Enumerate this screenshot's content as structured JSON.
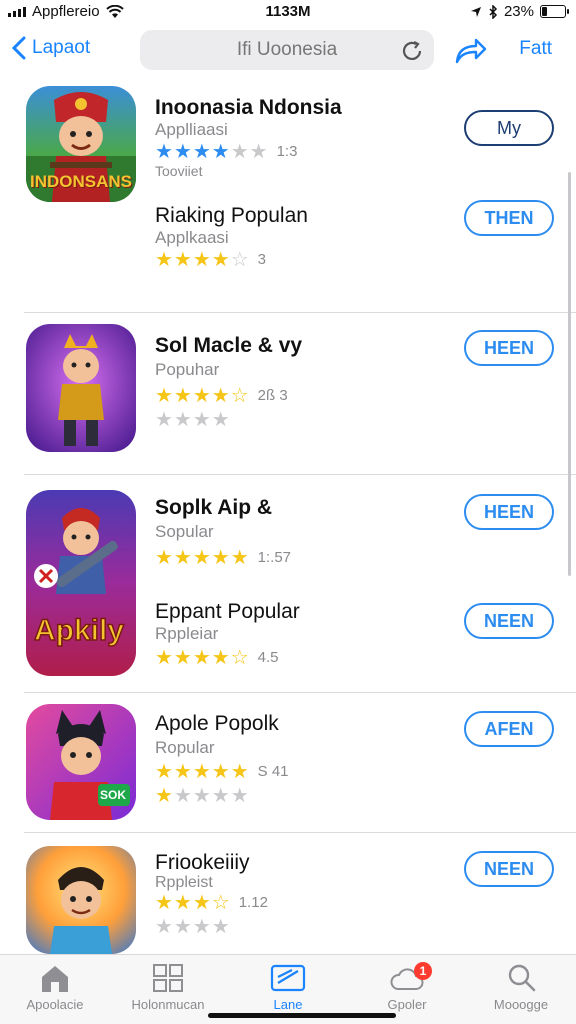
{
  "status_bar": {
    "carrier": "Appflereio",
    "time": "1133M",
    "battery": "23%",
    "battery_level": 0.23
  },
  "nav": {
    "back_label": "Lapaot",
    "search_text": "Ifi Uoonesia",
    "action_label": "Fatt"
  },
  "apps": [
    {
      "title": "Inoonasia Ndonsia",
      "subtitle": "Applliaasi",
      "stars_text": "★★★★",
      "stars_off_text": "★★",
      "rating_text": "1:3",
      "extra": "Tooviiet",
      "button": "My",
      "icon_caption": "INDONSANS"
    },
    {
      "title": "Riaking Populan",
      "subtitle": "Applkaasi",
      "stars_text": "★★★★",
      "stars_off_text": "☆",
      "rating_text": "3",
      "button": "THEN"
    },
    {
      "title": "Sol Macle & vy",
      "subtitle": "Popuhar",
      "stars_text": "★★★★☆",
      "rating_text": "2ß 3",
      "stars2_off_text": "★★★★",
      "button": "HEEN"
    },
    {
      "title": "Soplk Aip &",
      "subtitle": "Sopular",
      "stars_text": "★★★★★",
      "rating_text": "1:.57",
      "button": "HEEN",
      "icon_caption": "Apkily"
    },
    {
      "title": "Eppant Popular",
      "subtitle": "Rppleiar",
      "stars_text": "★★★★☆",
      "rating_text": "4.5",
      "button": "NEEN"
    },
    {
      "title": "Apole Popolk",
      "subtitle": "Ropular",
      "stars_text": "★★★★★",
      "rating_text": "S 41",
      "stars2_text": "★",
      "stars2_off_text": "★★★★",
      "button": "AFEN",
      "icon_badge": "SOK"
    },
    {
      "title": "Friookeiiiy",
      "subtitle": "Rppleist",
      "stars_text": "★★★☆",
      "rating_text": "1.12",
      "stars2_off_text": "★★★★",
      "button": "NEEN"
    }
  ],
  "tabs": [
    {
      "label": "Apoolacie"
    },
    {
      "label": "Holonmucan"
    },
    {
      "label": "Lane"
    },
    {
      "label": "Gpoler",
      "badge": "1"
    },
    {
      "label": "Mooogge"
    }
  ],
  "colors": {
    "accent": "#1a84ff",
    "star": "#f5c518",
    "button_border": "#2d8cf0",
    "badge": "#ff3b30"
  }
}
